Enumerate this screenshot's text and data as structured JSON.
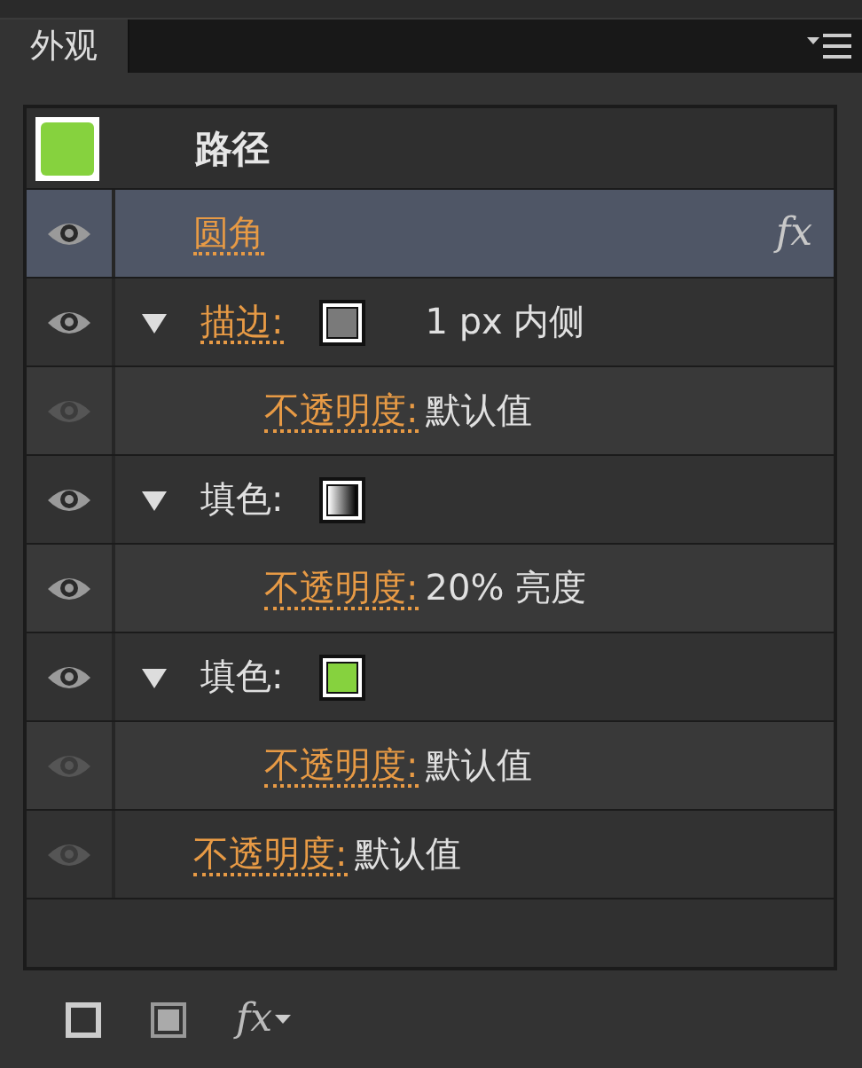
{
  "panel": {
    "tab": {
      "label": "外观",
      "selected": true
    }
  },
  "header": {
    "color": "#86d23e",
    "label": "路径"
  },
  "items": [
    {
      "kind": "effect",
      "label": "圆角",
      "link": true,
      "visible": true,
      "selected": true,
      "badge": "fx"
    },
    {
      "kind": "stroke",
      "label": "描边:",
      "link": true,
      "visible": true,
      "selected": false,
      "expanded": true,
      "color": "#7a7a7a",
      "value": "1 px  内侧",
      "children": [
        {
          "kind": "opacity",
          "label": "不透明度:",
          "link": true,
          "visible": false,
          "selected": false,
          "value": "默认值"
        }
      ]
    },
    {
      "kind": "fill",
      "label": "填色:",
      "link": false,
      "visible": true,
      "selected": false,
      "expanded": true,
      "gradient": true,
      "children": [
        {
          "kind": "opacity",
          "label": "不透明度:",
          "link": true,
          "visible": true,
          "selected": false,
          "value": "20% 亮度"
        }
      ]
    },
    {
      "kind": "fill",
      "label": "填色:",
      "link": false,
      "visible": true,
      "selected": false,
      "expanded": true,
      "color": "#86d23e",
      "children": [
        {
          "kind": "opacity",
          "label": "不透明度:",
          "link": true,
          "visible": false,
          "selected": false,
          "value": "默认值"
        }
      ]
    },
    {
      "kind": "opacity",
      "label": "不透明度:",
      "link": true,
      "visible": false,
      "selected": false,
      "value": "默认值"
    }
  ],
  "toolbar": {
    "fx_label": "fx"
  }
}
